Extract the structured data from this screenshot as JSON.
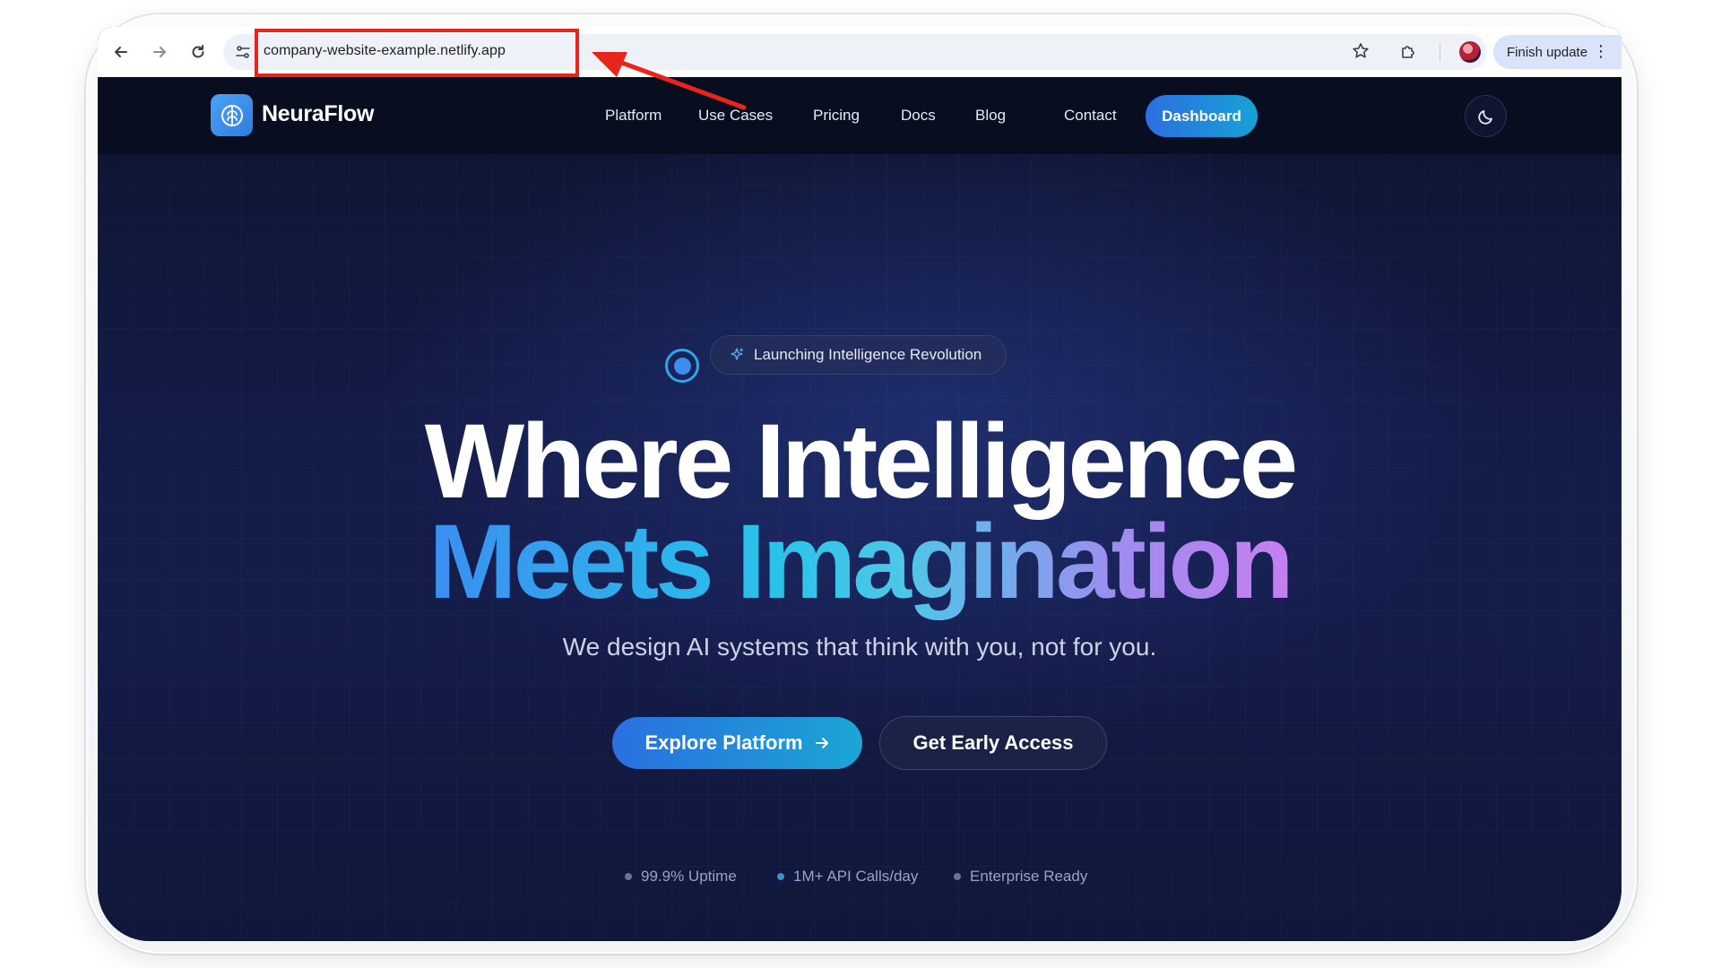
{
  "browser": {
    "url": "company-website-example.netlify.app",
    "finish_update_label": "Finish update",
    "icons": {
      "back": "back-arrow-icon",
      "forward": "forward-arrow-icon",
      "reload": "reload-icon",
      "site_info": "site-settings-icon",
      "bookmark": "star-icon",
      "extensions": "puzzle-icon",
      "menu": "more-vertical-icon"
    }
  },
  "nav": {
    "brand": "NeuraFlow",
    "items": [
      {
        "label": "Platform"
      },
      {
        "label": "Use Cases"
      },
      {
        "label": "Pricing"
      },
      {
        "label": "Docs"
      },
      {
        "label": "Blog"
      },
      {
        "label": "Contact"
      }
    ],
    "dashboard_label": "Dashboard"
  },
  "hero": {
    "badge": "Launching Intelligence Revolution",
    "headline_line1": "Where Intelligence",
    "headline_line2": "Meets Imagination",
    "subtitle": "We design AI systems that think with you, not for you.",
    "primary_cta": "Explore Platform",
    "secondary_cta": "Get Early Access"
  },
  "stats": [
    {
      "label": "99.9% Uptime",
      "dot_color": "#6b7390"
    },
    {
      "label": "1M+ API Calls/day",
      "dot_color": "#3a8fd6"
    },
    {
      "label": "Enterprise Ready",
      "dot_color": "#6b7390"
    }
  ],
  "colors": {
    "annotation": "#e8241b",
    "accent_blue": "#2a6fe0",
    "accent_cyan": "#1ba6d4",
    "gradient_purple": "#c77ef0"
  }
}
